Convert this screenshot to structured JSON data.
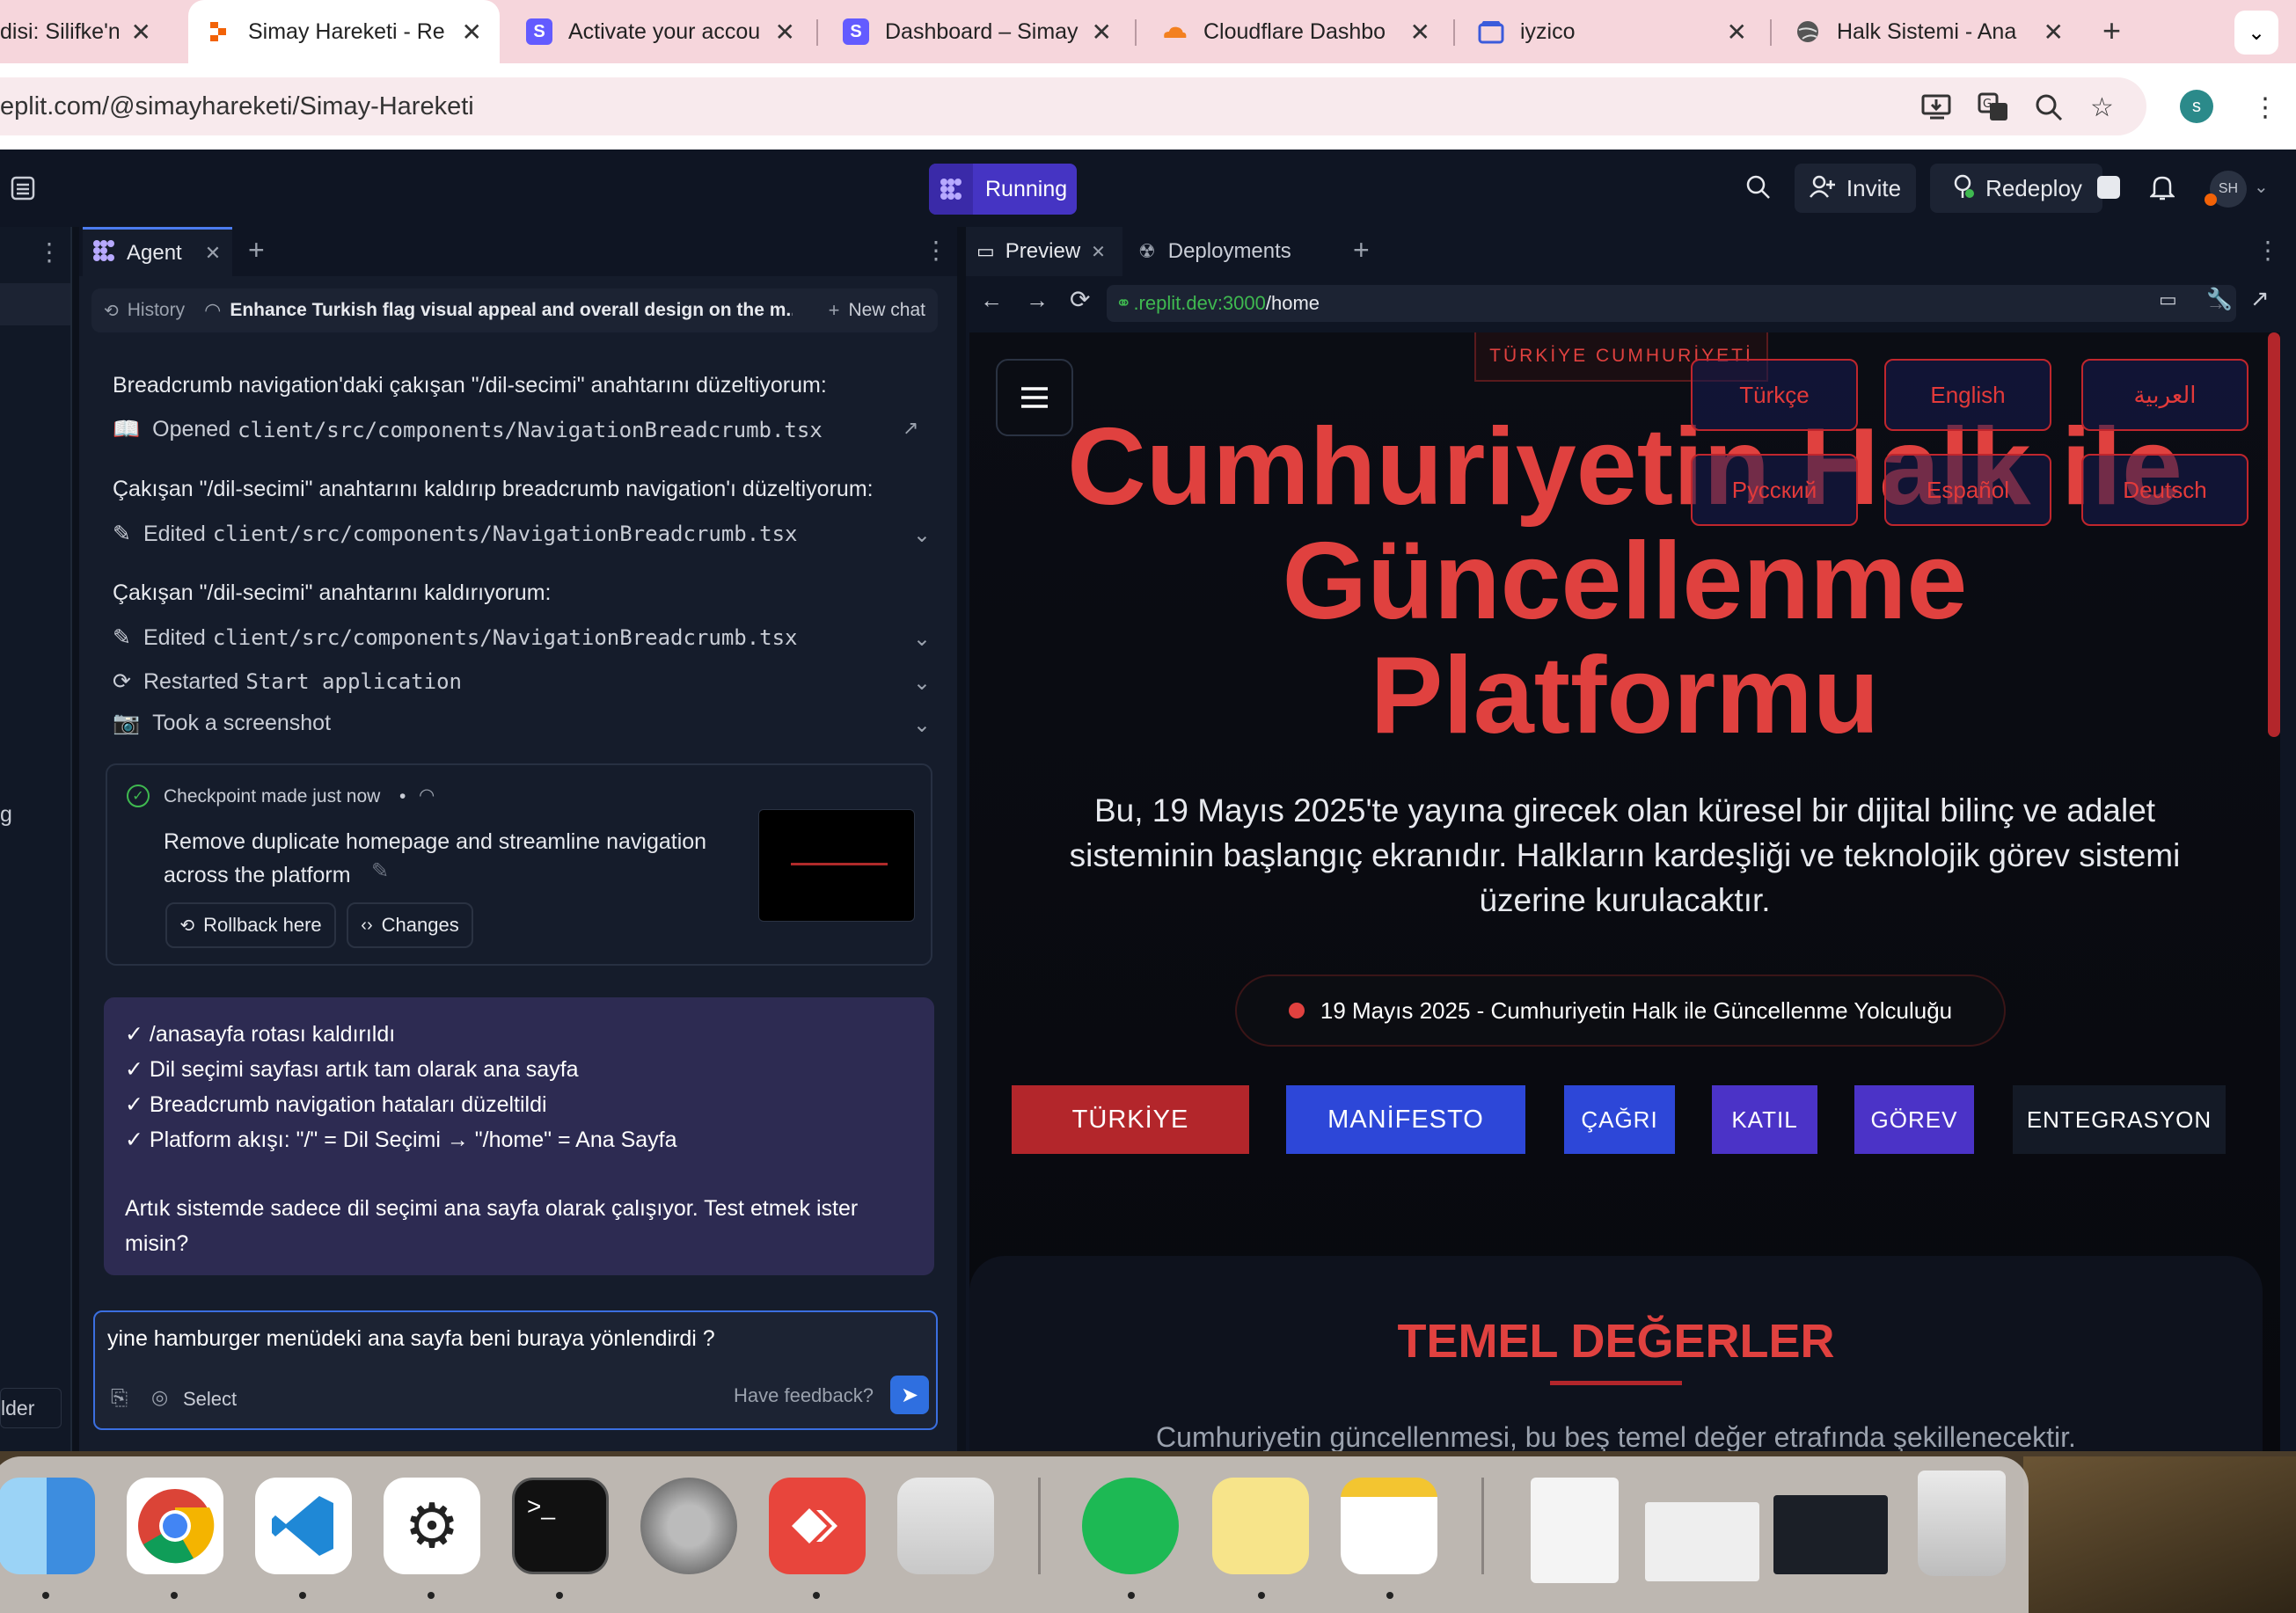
{
  "browser": {
    "tabs": [
      {
        "title": "disi: Silifke'n",
        "icon": "generic-favicon"
      },
      {
        "title": "Simay Hareketi - Re",
        "icon": "replit-favicon",
        "active": true
      },
      {
        "title": "Activate your accou",
        "icon": "s-favicon"
      },
      {
        "title": "Dashboard – Simay",
        "icon": "s-favicon"
      },
      {
        "title": "Cloudflare Dashbo",
        "icon": "cloudflare-favicon"
      },
      {
        "title": "iyzico",
        "icon": "iyzico-favicon"
      },
      {
        "title": "Halk Sistemi - Ana",
        "icon": "globe-favicon"
      }
    ],
    "url": "eplit.com/@simayhareketi/Simay-Hareketi",
    "profile_initial": "s"
  },
  "replit": {
    "status": "Running",
    "invite_label": "Invite",
    "redeploy_label": "Redeploy",
    "avatar_initials": "SH"
  },
  "agent": {
    "tab_label": "Agent",
    "history_label": "History",
    "chat_title": "Enhance Turkish flag visual appeal and overall design on the m...",
    "new_chat_label": "New chat",
    "messages": [
      "Breadcrumb navigation'daki çakışan \"/dil-secimi\" anahtarını düzeltiyorum:",
      "Çakışan \"/dil-secimi\" anahtarını kaldırıp breadcrumb navigation'ı düzeltiyorum:",
      "Çakışan \"/dil-secimi\" anahtarını kaldırıyorum:"
    ],
    "actions": {
      "opened_verb": "Opened",
      "opened_file": "client/src/components/NavigationBreadcrumb.tsx",
      "edited_verb": "Edited",
      "edited_file": "client/src/components/NavigationBreadcrumb.tsx",
      "edited2_verb": "Edited",
      "edited2_file": "client/src/components/NavigationBreadcrumb.tsx",
      "restarted_verb": "Restarted",
      "restarted_target": "Start application",
      "screenshot": "Took a screenshot"
    },
    "checkpoint": {
      "status": "Checkpoint made just now",
      "description": "Remove duplicate homepage and streamline navigation across the platform",
      "rollback_label": "Rollback here",
      "changes_label": "Changes"
    },
    "summary_lines": [
      "✓ /anasayfa rotası kaldırıldı",
      "✓ Dil seçimi sayfası artık tam olarak ana sayfa",
      "✓ Breadcrumb navigation hataları düzeltildi",
      "✓ Platform akışı: \"/\" = Dil Seçimi → \"/home\" = Ana Sayfa"
    ],
    "summary_question": "Artık sistemde sadece dil seçimi ana sayfa olarak çalışıyor. Test etmek ister misin?",
    "input_value": "yine hamburger menüdeki ana sayfa beni buraya yönlendirdi ?",
    "select_label": "Select",
    "feedback_label": "Have feedback?"
  },
  "left_edge": {
    "label_g": "g",
    "label_folder": "lder"
  },
  "preview": {
    "tab_preview": "Preview",
    "tab_deployments": "Deployments",
    "url_prefix": ".replit.dev:3000",
    "url_path": "/home",
    "site": {
      "badge": "TÜRKİYE CUMHURİYETİ",
      "heading_lines": [
        "Cumhuriyetin Halk ile",
        "Güncellenme",
        "Platformu"
      ],
      "description": "Bu, 19 Mayıs 2025'te yayına girecek olan küresel bir dijital bilinç ve adalet sisteminin başlangıç ekranıdır. Halkların kardeşliği ve teknolojik görev sistemi üzerine kurulacaktır.",
      "pill": "19 Mayıs 2025 - Cumhuriyetin Halk ile Güncellenme Yolculuğu",
      "languages": [
        "Türkçe",
        "English",
        "العربية",
        "Русский",
        "Español",
        "Deutsch"
      ],
      "nav_buttons": [
        "TÜRKİYE",
        "MANİFESTO",
        "ÇAĞRI",
        "KATIL",
        "GÖREV",
        "ENTEGRASYON"
      ],
      "section_title": "TEMEL DEĞERLER",
      "section_text": "Cumhuriyetin güncellenmesi, bu beş temel değer etrafında şekillenecektir."
    }
  },
  "colors": {
    "accent_red": "#e0413f",
    "replit_purple": "#5b3fd6",
    "nav_blue": "#2d47d8"
  }
}
